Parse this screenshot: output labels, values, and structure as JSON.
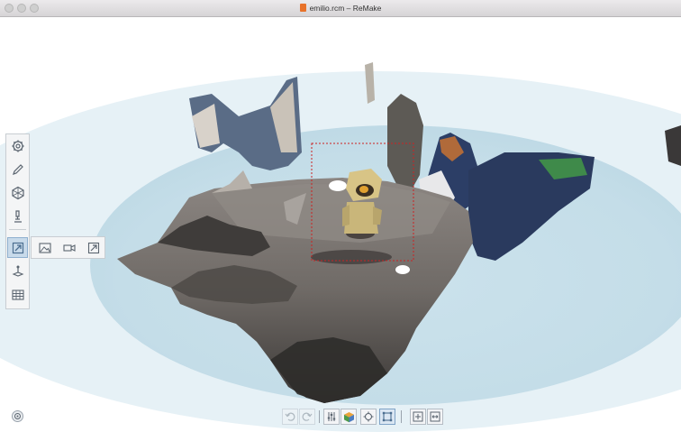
{
  "window": {
    "title": "emilio.rcm – ReMake",
    "buttons": [
      "close",
      "minimize",
      "zoom"
    ]
  },
  "colors": {
    "ground_plane": "#c9e0ea",
    "ground_plane_far": "#e4eff4",
    "selection_box": "#cc2222",
    "active_tool": "#c8daea",
    "accent_icon": "#5b89b5"
  },
  "left_toolbar": {
    "items": [
      {
        "name": "settings",
        "icon": "gear-icon"
      },
      {
        "name": "edit",
        "icon": "pencil-icon"
      },
      {
        "name": "analyze",
        "icon": "hexagon-icon"
      },
      {
        "name": "3d-print",
        "icon": "microscope-icon"
      },
      {
        "name": "export",
        "icon": "export-arrow-icon",
        "active": true
      },
      {
        "name": "orient",
        "icon": "orient-icon"
      },
      {
        "name": "grid",
        "icon": "grid-icon"
      }
    ]
  },
  "export_flyout": {
    "items": [
      {
        "name": "export-image",
        "icon": "image-icon"
      },
      {
        "name": "export-video",
        "icon": "video-camera-icon"
      },
      {
        "name": "export-model",
        "icon": "export-arrow-icon"
      }
    ]
  },
  "bottom_toolbar": {
    "items": [
      {
        "name": "undo",
        "icon": "undo-icon",
        "enabled": false
      },
      {
        "name": "redo",
        "icon": "redo-icon",
        "enabled": false
      },
      {
        "name": "adjust",
        "icon": "sliders-icon",
        "enabled": true
      },
      {
        "name": "material",
        "icon": "textured-cube-icon",
        "enabled": true
      },
      {
        "name": "center-view",
        "icon": "crosshair-icon",
        "enabled": true
      },
      {
        "name": "bounding-box",
        "icon": "bounding-box-icon",
        "enabled": true
      },
      {
        "name": "fit-view",
        "icon": "fit-view-icon",
        "enabled": true
      },
      {
        "name": "fit-width",
        "icon": "fit-width-icon",
        "enabled": true
      }
    ]
  }
}
